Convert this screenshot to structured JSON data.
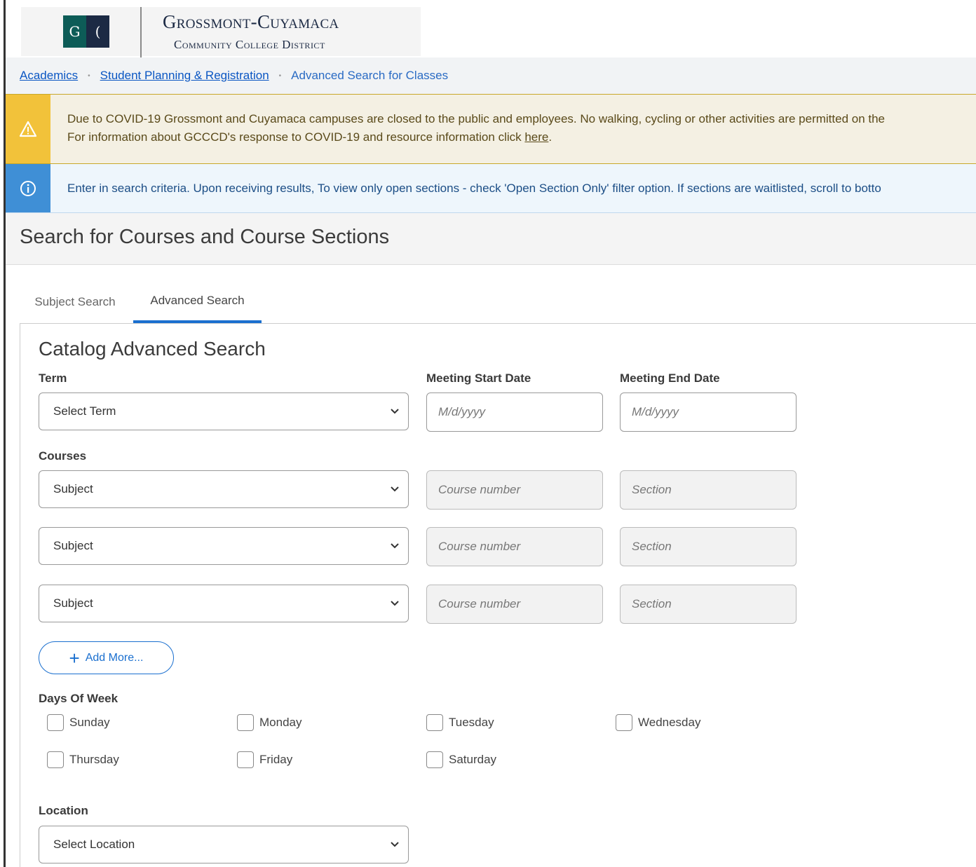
{
  "header": {
    "logo_letter_left": "G",
    "logo_letter_right": "(",
    "title": "Grossmont-Cuyamaca",
    "subtitle": "Community College District"
  },
  "breadcrumb": {
    "items": [
      "Academics",
      "Student Planning & Registration"
    ],
    "current": "Advanced Search for Classes",
    "separator": "•"
  },
  "alerts": {
    "warning_line1": "Due to COVID-19 Grossmont and Cuyamaca campuses are closed to the public and employees. No walking, cycling or other activities are permitted on the",
    "warning_line2_prefix": "For information about GCCCD's response to COVID-19 and resource information click ",
    "warning_link": "here",
    "warning_line2_suffix": ".",
    "info": "Enter in search criteria. Upon receiving results, To view only open sections - check 'Open Section Only' filter option. If sections are waitlisted, scroll to botto"
  },
  "page": {
    "title": "Search for Courses and Course Sections"
  },
  "tabs": {
    "subject": "Subject Search",
    "advanced": "Advanced Search",
    "active": "Advanced Search"
  },
  "form": {
    "section_title": "Catalog Advanced Search",
    "term_label": "Term",
    "term_value": "Select Term",
    "start_date_label": "Meeting Start Date",
    "end_date_label": "Meeting End Date",
    "date_placeholder": "M/d/yyyy",
    "courses_label": "Courses",
    "subject_value": "Subject",
    "course_number_placeholder": "Course number",
    "section_placeholder": "Section",
    "add_more": "Add More...",
    "days_label": "Days Of Week",
    "days": [
      "Sunday",
      "Monday",
      "Tuesday",
      "Wednesday",
      "Thursday",
      "Friday",
      "Saturday"
    ],
    "location_label": "Location",
    "location_value": "Select Location"
  },
  "colors": {
    "accent": "#1a6fcf",
    "link": "#0a56c3",
    "warning": "#f2c23a",
    "info": "#3f8fd6",
    "brand_green": "#0d5c57",
    "brand_navy": "#1c2a44"
  }
}
